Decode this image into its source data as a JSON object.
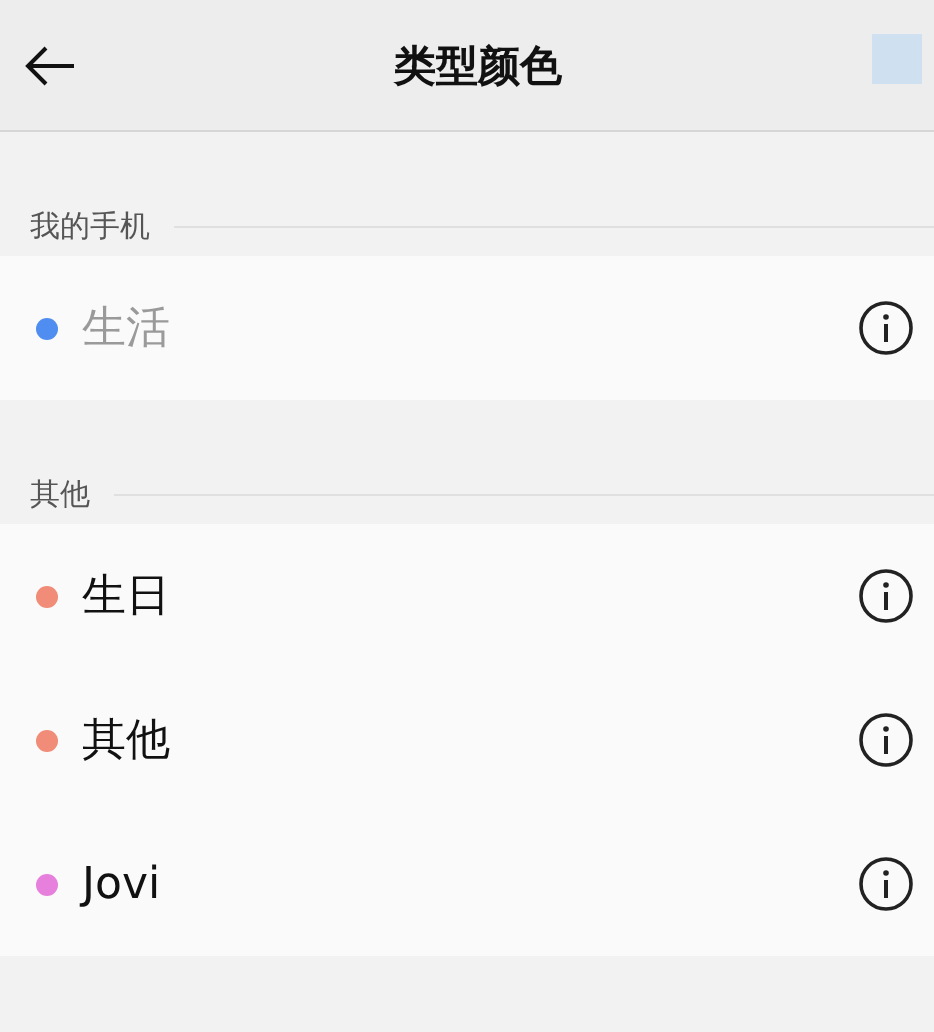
{
  "header": {
    "title": "类型颜色"
  },
  "sections": [
    {
      "label": "我的手机",
      "items": [
        {
          "name": "生活",
          "color": "#4f8ef0",
          "disabled": true
        }
      ]
    },
    {
      "label": "其他",
      "items": [
        {
          "name": "生日",
          "color": "#f08c78",
          "disabled": false
        },
        {
          "name": "其他",
          "color": "#f08c78",
          "disabled": false
        },
        {
          "name": "Jovi",
          "color": "#e680dc",
          "disabled": false
        }
      ]
    }
  ]
}
